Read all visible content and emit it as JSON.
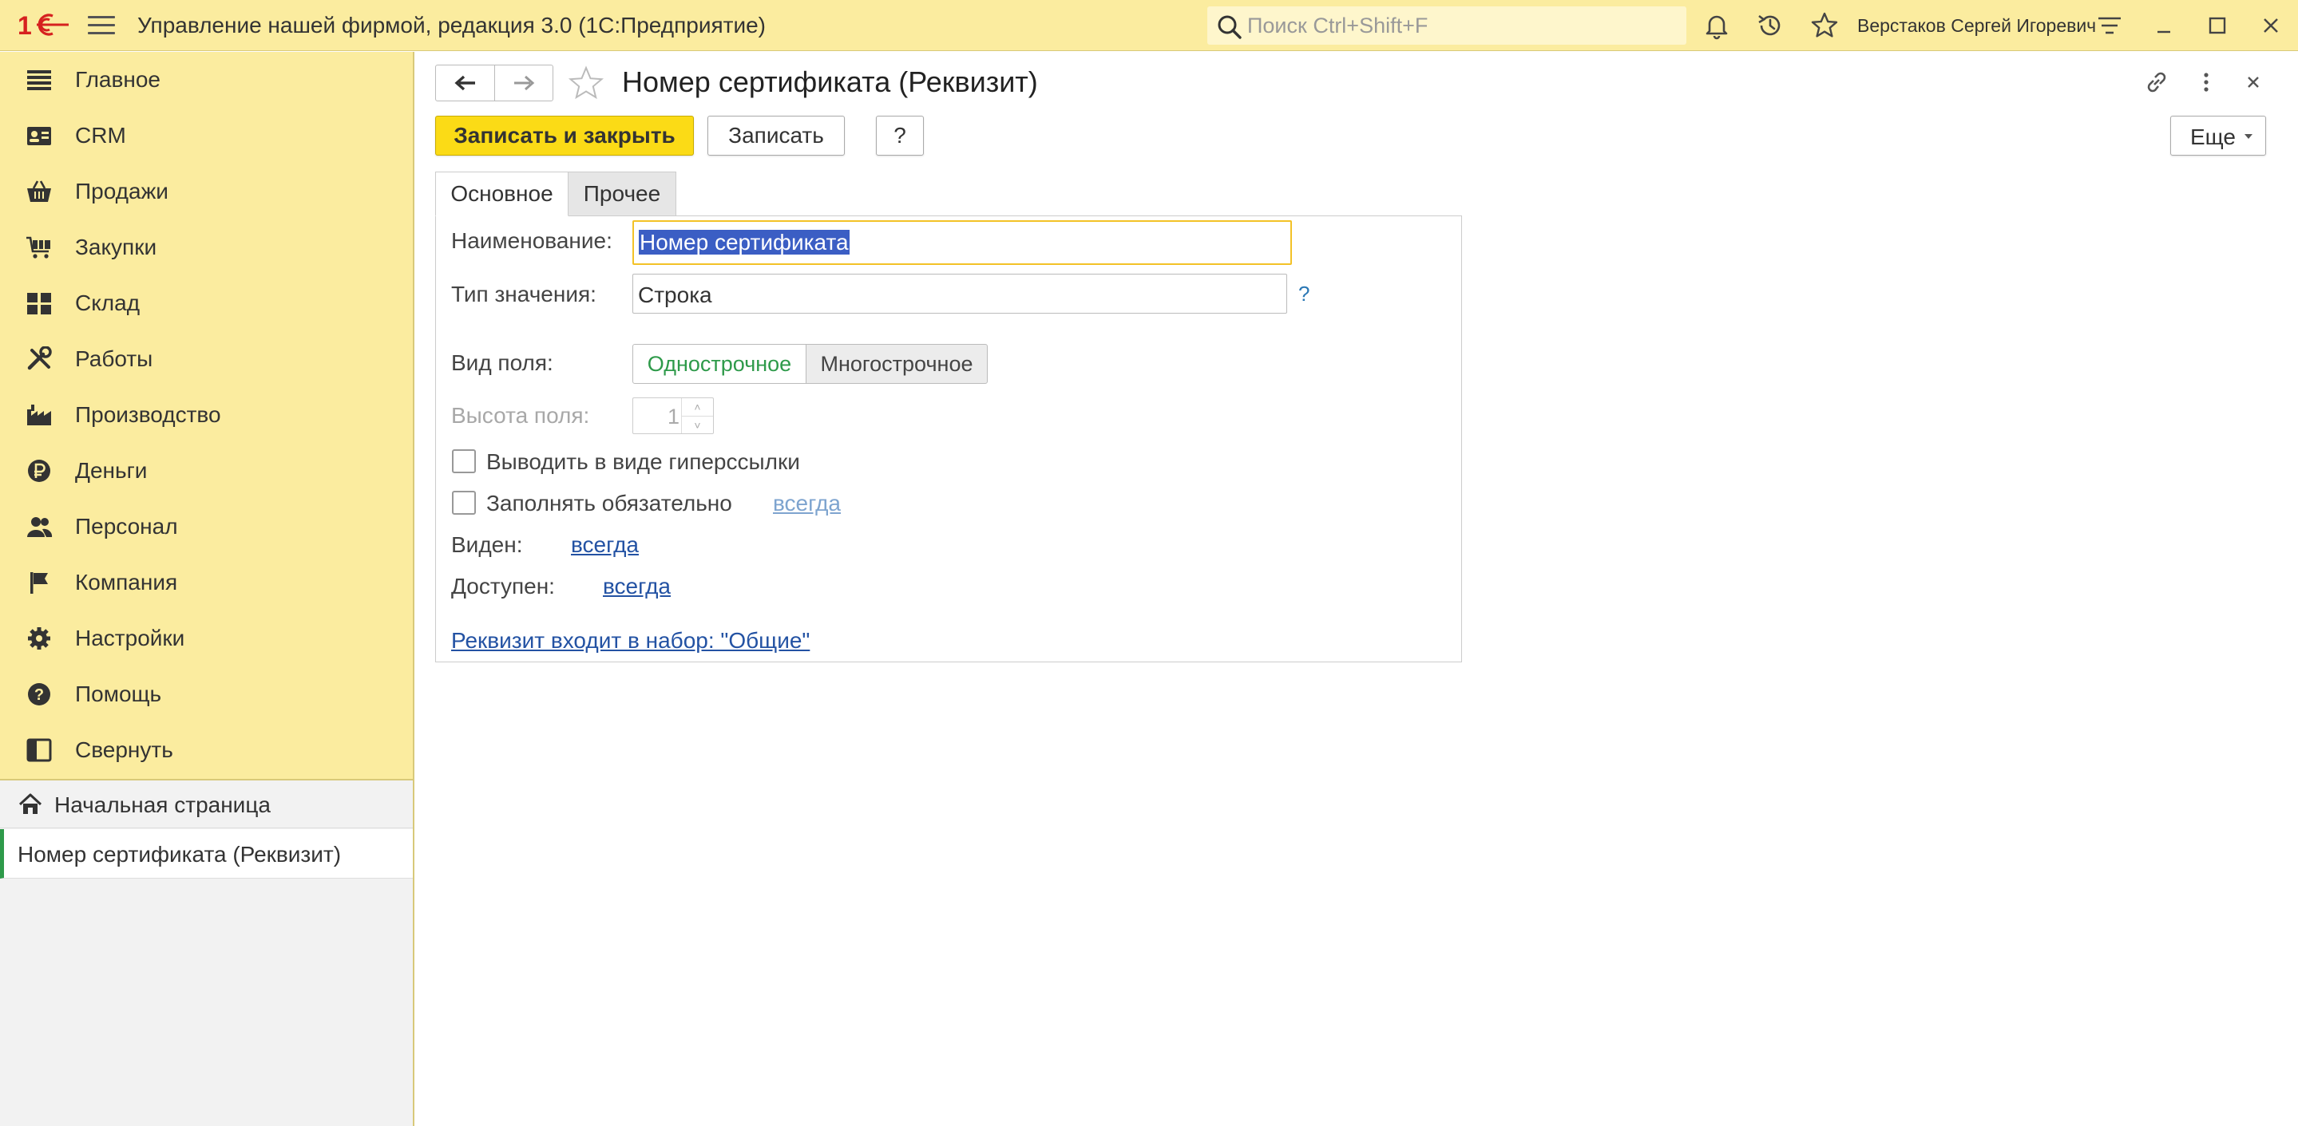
{
  "topbar": {
    "app_title": "Управление нашей фирмой, редакция 3.0  (1С:Предприятие)",
    "search_placeholder": "Поиск Ctrl+Shift+F",
    "user_name": "Верстаков Сергей Игоревич"
  },
  "sidebar": {
    "items": [
      {
        "label": "Главное",
        "icon": "menu-list-icon"
      },
      {
        "label": "CRM",
        "icon": "contact-card-icon"
      },
      {
        "label": "Продажи",
        "icon": "basket-icon"
      },
      {
        "label": "Закупки",
        "icon": "cart-icon"
      },
      {
        "label": "Склад",
        "icon": "warehouse-grid-icon"
      },
      {
        "label": "Работы",
        "icon": "tools-icon"
      },
      {
        "label": "Производство",
        "icon": "factory-icon"
      },
      {
        "label": "Деньги",
        "icon": "ruble-coin-icon"
      },
      {
        "label": "Персонал",
        "icon": "people-icon"
      },
      {
        "label": "Компания",
        "icon": "flag-icon"
      },
      {
        "label": "Настройки",
        "icon": "gear-icon"
      },
      {
        "label": "Помощь",
        "icon": "question-circle-icon"
      },
      {
        "label": "Свернуть",
        "icon": "collapse-panel-icon"
      }
    ],
    "home_label": "Начальная страница",
    "open_window_label": "Номер сертификата (Реквизит)"
  },
  "form": {
    "title": "Номер сертификата (Реквизит)",
    "save_close_label": "Записать и закрыть",
    "save_label": "Записать",
    "help_label": "?",
    "more_label": "Еще",
    "tabs": [
      {
        "label": "Основное",
        "active": true
      },
      {
        "label": "Прочее",
        "active": false
      }
    ],
    "name_label": "Наименование:",
    "name_value": "Номер сертификата",
    "type_label": "Тип значения:",
    "type_value": "Строка",
    "type_help": "?",
    "view_label": "Вид поля:",
    "view_options": [
      "Однострочное",
      "Многострочное"
    ],
    "view_selected": "Однострочное",
    "height_label": "Высота поля:",
    "height_value": "1",
    "hyperlink_checkbox_label": "Выводить в виде гиперссылки",
    "hyperlink_checked": false,
    "required_checkbox_label": "Заполнять обязательно",
    "required_checked": false,
    "required_link": "всегда",
    "visible_label": "Виден:",
    "visible_link": "всегда",
    "available_label": "Доступен:",
    "available_link": "всегда",
    "set_link": "Реквизит входит в набор: \"Общие\""
  },
  "colors": {
    "panel_yellow": "#fbec9f",
    "primary_button": "#fbdb16",
    "active_green": "#2e9a4a",
    "link_blue": "#2352a3",
    "selection_blue": "#3b5ec4",
    "focus_border": "#f3c227"
  }
}
